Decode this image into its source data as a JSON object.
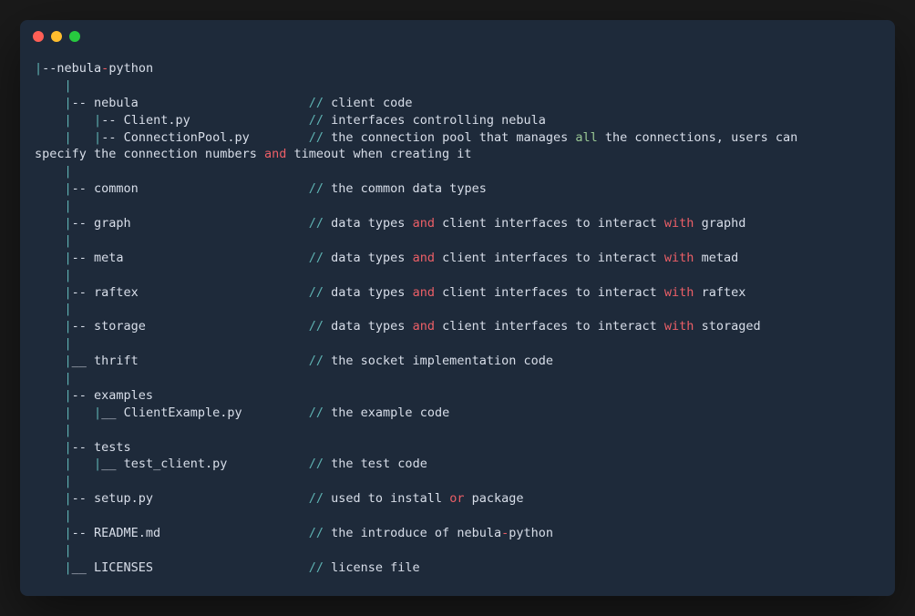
{
  "colors": {
    "background": "#1e2a3a",
    "text": "#d8dee9",
    "cyan": "#5fb3b3",
    "red": "#ec5f67",
    "green": "#99c794"
  },
  "lines": [
    [
      {
        "t": "|",
        "c": "cyan"
      },
      {
        "t": "--nebula",
        "c": ""
      },
      {
        "t": "-",
        "c": "red-kw"
      },
      {
        "t": "python",
        "c": ""
      }
    ],
    [
      {
        "t": "    ",
        "c": ""
      },
      {
        "t": "|",
        "c": "cyan"
      }
    ],
    [
      {
        "t": "    ",
        "c": ""
      },
      {
        "t": "|",
        "c": "cyan"
      },
      {
        "t": "-- nebula                       ",
        "c": ""
      },
      {
        "t": "//",
        "c": "cyan"
      },
      {
        "t": " client code",
        "c": ""
      }
    ],
    [
      {
        "t": "    ",
        "c": ""
      },
      {
        "t": "|",
        "c": "cyan"
      },
      {
        "t": "   ",
        "c": ""
      },
      {
        "t": "|",
        "c": "cyan"
      },
      {
        "t": "-- Client.py                ",
        "c": ""
      },
      {
        "t": "//",
        "c": "cyan"
      },
      {
        "t": " interfaces controlling nebula",
        "c": ""
      }
    ],
    [
      {
        "t": "    ",
        "c": ""
      },
      {
        "t": "|",
        "c": "cyan"
      },
      {
        "t": "   ",
        "c": ""
      },
      {
        "t": "|",
        "c": "cyan"
      },
      {
        "t": "-- ConnectionPool.py        ",
        "c": ""
      },
      {
        "t": "//",
        "c": "cyan"
      },
      {
        "t": " the connection pool that manages ",
        "c": ""
      },
      {
        "t": "all",
        "c": "green-kw"
      },
      {
        "t": " the connections, users can ",
        "c": ""
      }
    ],
    [
      {
        "t": "specify the connection numbers ",
        "c": ""
      },
      {
        "t": "and",
        "c": "red-kw"
      },
      {
        "t": " timeout when creating it",
        "c": ""
      }
    ],
    [
      {
        "t": "    ",
        "c": ""
      },
      {
        "t": "|",
        "c": "cyan"
      }
    ],
    [
      {
        "t": "    ",
        "c": ""
      },
      {
        "t": "|",
        "c": "cyan"
      },
      {
        "t": "-- common                       ",
        "c": ""
      },
      {
        "t": "//",
        "c": "cyan"
      },
      {
        "t": " the common data types",
        "c": ""
      }
    ],
    [
      {
        "t": "    ",
        "c": ""
      },
      {
        "t": "|",
        "c": "cyan"
      }
    ],
    [
      {
        "t": "    ",
        "c": ""
      },
      {
        "t": "|",
        "c": "cyan"
      },
      {
        "t": "-- graph                        ",
        "c": ""
      },
      {
        "t": "//",
        "c": "cyan"
      },
      {
        "t": " data types ",
        "c": ""
      },
      {
        "t": "and",
        "c": "red-kw"
      },
      {
        "t": " client interfaces to interact ",
        "c": ""
      },
      {
        "t": "with",
        "c": "red-kw"
      },
      {
        "t": " graphd",
        "c": ""
      }
    ],
    [
      {
        "t": "    ",
        "c": ""
      },
      {
        "t": "|",
        "c": "cyan"
      }
    ],
    [
      {
        "t": "    ",
        "c": ""
      },
      {
        "t": "|",
        "c": "cyan"
      },
      {
        "t": "-- meta                         ",
        "c": ""
      },
      {
        "t": "//",
        "c": "cyan"
      },
      {
        "t": " data types ",
        "c": ""
      },
      {
        "t": "and",
        "c": "red-kw"
      },
      {
        "t": " client interfaces to interact ",
        "c": ""
      },
      {
        "t": "with",
        "c": "red-kw"
      },
      {
        "t": " metad",
        "c": ""
      }
    ],
    [
      {
        "t": "    ",
        "c": ""
      },
      {
        "t": "|",
        "c": "cyan"
      }
    ],
    [
      {
        "t": "    ",
        "c": ""
      },
      {
        "t": "|",
        "c": "cyan"
      },
      {
        "t": "-- raftex                       ",
        "c": ""
      },
      {
        "t": "//",
        "c": "cyan"
      },
      {
        "t": " data types ",
        "c": ""
      },
      {
        "t": "and",
        "c": "red-kw"
      },
      {
        "t": " client interfaces to interact ",
        "c": ""
      },
      {
        "t": "with",
        "c": "red-kw"
      },
      {
        "t": " raftex",
        "c": ""
      }
    ],
    [
      {
        "t": "    ",
        "c": ""
      },
      {
        "t": "|",
        "c": "cyan"
      }
    ],
    [
      {
        "t": "    ",
        "c": ""
      },
      {
        "t": "|",
        "c": "cyan"
      },
      {
        "t": "-- storage                      ",
        "c": ""
      },
      {
        "t": "//",
        "c": "cyan"
      },
      {
        "t": " data types ",
        "c": ""
      },
      {
        "t": "and",
        "c": "red-kw"
      },
      {
        "t": " client interfaces to interact ",
        "c": ""
      },
      {
        "t": "with",
        "c": "red-kw"
      },
      {
        "t": " storaged",
        "c": ""
      }
    ],
    [
      {
        "t": "    ",
        "c": ""
      },
      {
        "t": "|",
        "c": "cyan"
      }
    ],
    [
      {
        "t": "    ",
        "c": ""
      },
      {
        "t": "|",
        "c": "cyan"
      },
      {
        "t": "__ thrift                       ",
        "c": ""
      },
      {
        "t": "//",
        "c": "cyan"
      },
      {
        "t": " the socket implementation code",
        "c": ""
      }
    ],
    [
      {
        "t": "    ",
        "c": ""
      },
      {
        "t": "|",
        "c": "cyan"
      }
    ],
    [
      {
        "t": "    ",
        "c": ""
      },
      {
        "t": "|",
        "c": "cyan"
      },
      {
        "t": "-- examples",
        "c": ""
      }
    ],
    [
      {
        "t": "    ",
        "c": ""
      },
      {
        "t": "|",
        "c": "cyan"
      },
      {
        "t": "   ",
        "c": ""
      },
      {
        "t": "|",
        "c": "cyan"
      },
      {
        "t": "__ ClientExample.py         ",
        "c": ""
      },
      {
        "t": "//",
        "c": "cyan"
      },
      {
        "t": " the example code",
        "c": ""
      }
    ],
    [
      {
        "t": "    ",
        "c": ""
      },
      {
        "t": "|",
        "c": "cyan"
      }
    ],
    [
      {
        "t": "    ",
        "c": ""
      },
      {
        "t": "|",
        "c": "cyan"
      },
      {
        "t": "-- tests",
        "c": ""
      }
    ],
    [
      {
        "t": "    ",
        "c": ""
      },
      {
        "t": "|",
        "c": "cyan"
      },
      {
        "t": "   ",
        "c": ""
      },
      {
        "t": "|",
        "c": "cyan"
      },
      {
        "t": "__ test_client.py           ",
        "c": ""
      },
      {
        "t": "//",
        "c": "cyan"
      },
      {
        "t": " the test code",
        "c": ""
      }
    ],
    [
      {
        "t": "    ",
        "c": ""
      },
      {
        "t": "|",
        "c": "cyan"
      }
    ],
    [
      {
        "t": "    ",
        "c": ""
      },
      {
        "t": "|",
        "c": "cyan"
      },
      {
        "t": "-- setup.py                     ",
        "c": ""
      },
      {
        "t": "//",
        "c": "cyan"
      },
      {
        "t": " used to install ",
        "c": ""
      },
      {
        "t": "or",
        "c": "red-kw"
      },
      {
        "t": " package",
        "c": ""
      }
    ],
    [
      {
        "t": "    ",
        "c": ""
      },
      {
        "t": "|",
        "c": "cyan"
      }
    ],
    [
      {
        "t": "    ",
        "c": ""
      },
      {
        "t": "|",
        "c": "cyan"
      },
      {
        "t": "-- README.md                    ",
        "c": ""
      },
      {
        "t": "//",
        "c": "cyan"
      },
      {
        "t": " the introduce of nebula",
        "c": ""
      },
      {
        "t": "-",
        "c": "red-kw"
      },
      {
        "t": "python",
        "c": ""
      }
    ],
    [
      {
        "t": "    ",
        "c": ""
      },
      {
        "t": "|",
        "c": "cyan"
      }
    ],
    [
      {
        "t": "    ",
        "c": ""
      },
      {
        "t": "|",
        "c": "cyan"
      },
      {
        "t": "__ LICENSES                     ",
        "c": ""
      },
      {
        "t": "//",
        "c": "cyan"
      },
      {
        "t": " license file",
        "c": ""
      }
    ]
  ]
}
